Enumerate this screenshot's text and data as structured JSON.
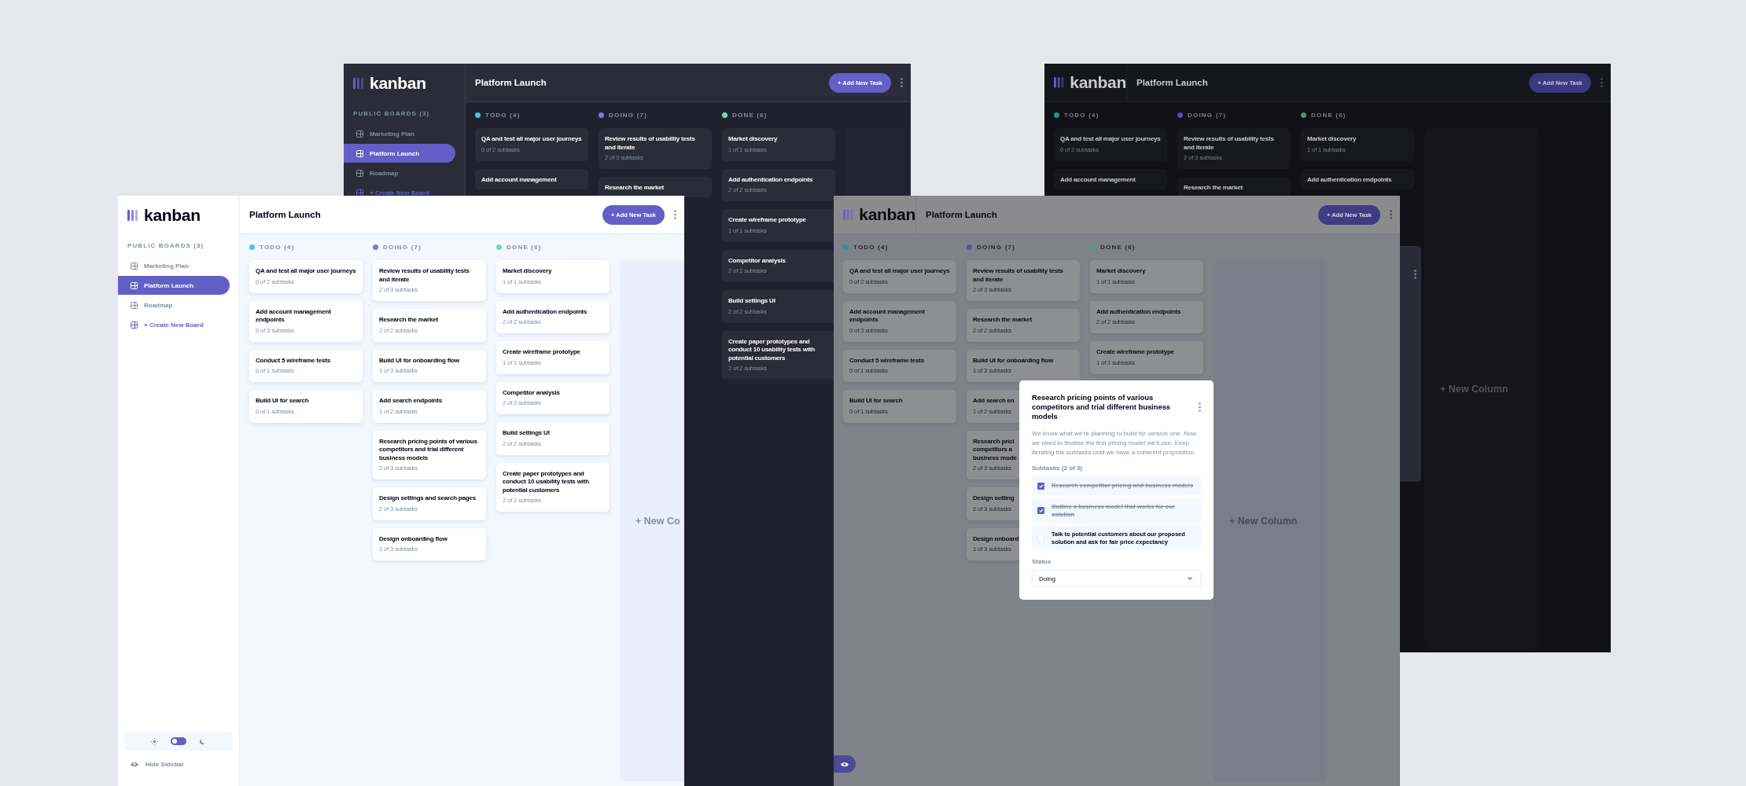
{
  "boards": [
    {
      "kind": "dark",
      "logo": "kanban",
      "sidebar": {
        "heading": "PUBLIC BOARDS (3)",
        "items": [
          {
            "label": "Marketing Plan",
            "selected": false
          },
          {
            "label": "Platform Launch",
            "selected": true
          },
          {
            "label": "Roadmap",
            "selected": false
          }
        ],
        "create_label": "+ Create New Board"
      },
      "title": "Platform Launch",
      "add_button": "+ Add New Task",
      "columns": [
        {
          "name": "TODO (4)",
          "color": "#49c4e5",
          "cards": [
            {
              "title": "QA and test all major user journeys",
              "subtasks": "0 of 2 subtasks"
            },
            {
              "title": "Add account management"
            }
          ]
        },
        {
          "name": "DOING (7)",
          "color": "#8471f2",
          "cards": [
            {
              "title": "Review results of usability tests and iterate",
              "subtasks": "2 of 3 subtasks"
            },
            {
              "title": "Research the market"
            }
          ]
        },
        {
          "name": "DONE (6)",
          "color": "#67e2ae",
          "cards": [
            {
              "title": "Market discovery",
              "subtasks": "1 of 1 subtasks"
            },
            {
              "title": "Add authentication endpoints",
              "subtasks": "2 of 2 subtasks"
            },
            {
              "title": "Create wireframe prototype",
              "subtasks": "1 of 1 subtasks"
            },
            {
              "title": "Competitor analysis",
              "subtasks": "2 of 2 subtasks"
            },
            {
              "title": "Build settings UI",
              "subtasks": "2 of 2 subtasks"
            },
            {
              "title": "Create paper prototypes and conduct 10 usability tests with potential customers",
              "subtasks": "2 of 2 subtasks"
            }
          ]
        }
      ]
    },
    {
      "kind": "dim-dark",
      "logo": "kanban",
      "title": "Platform Launch",
      "add_button": "+ Add New Task",
      "columns": [
        {
          "name": "TODO (4)",
          "color": "#2f8aa3",
          "cards": [
            {
              "title": "QA and test all major user journeys",
              "subtasks": "0 of 2 subtasks"
            },
            {
              "title": "Add account management"
            }
          ]
        },
        {
          "name": "DOING (7)",
          "color": "#5a4cb5",
          "cards": [
            {
              "title": "Review results of usability tests and iterate",
              "subtasks": "2 of 3 subtasks"
            },
            {
              "title": "Research the market"
            }
          ]
        },
        {
          "name": "DONE (6)",
          "color": "#3f9a70",
          "cards": [
            {
              "title": "Market discovery",
              "subtasks": "1 of 1 subtasks"
            },
            {
              "title": "Add authentication endpoints"
            }
          ]
        }
      ],
      "new_column": "+ New Column",
      "modal": {
        "menu": true
      }
    },
    {
      "kind": "light",
      "logo": "kanban",
      "sidebar": {
        "heading": "PUBLIC BOARDS (3)",
        "items": [
          {
            "label": "Marketing Plan",
            "selected": false
          },
          {
            "label": "Platform Launch",
            "selected": true
          },
          {
            "label": "Roadmap",
            "selected": false
          }
        ],
        "create_label": "+ Create New Board",
        "dark_mode": false,
        "hide_label": "Hide Sidebar"
      },
      "title": "Platform Launch",
      "add_button": "+ Add New Task",
      "columns": [
        {
          "name": "TODO (4)",
          "color": "#49c4e5",
          "cards": [
            {
              "title": "QA and test all major user journeys",
              "subtasks": "0 of 2 subtasks"
            },
            {
              "title": "Add account management endpoints",
              "subtasks": "0 of 3 subtasks"
            },
            {
              "title": "Conduct 5 wireframe tests",
              "subtasks": "0 of 1 subtasks"
            },
            {
              "title": "Build UI for search",
              "subtasks": "0 of 1 subtasks"
            }
          ]
        },
        {
          "name": "DOING (7)",
          "color": "#8471f2",
          "cards": [
            {
              "title": "Review results of usability tests and iterate",
              "subtasks": "2 of 3 subtasks"
            },
            {
              "title": "Research the market",
              "subtasks": "2 of 2 subtasks"
            },
            {
              "title": "Build UI for onboarding flow",
              "subtasks": "1 of 3 subtasks"
            },
            {
              "title": "Add search endpoints",
              "subtasks": "1 of 2 subtasks"
            },
            {
              "title": "Research pricing points of various competitors and trial different business models",
              "subtasks": "2 of 3 subtasks"
            },
            {
              "title": "Design settings and search pages",
              "subtasks": "2 of 3 subtasks"
            },
            {
              "title": "Design onboarding flow",
              "subtasks": "1 of 3 subtasks"
            }
          ]
        },
        {
          "name": "DONE (6)",
          "color": "#67e2ae",
          "cards": [
            {
              "title": "Market discovery",
              "subtasks": "1 of 1 subtasks"
            },
            {
              "title": "Add authentication endpoints",
              "subtasks": "2 of 2 subtasks"
            },
            {
              "title": "Create wireframe prototype",
              "subtasks": "1 of 1 subtasks"
            },
            {
              "title": "Competitor analysis",
              "subtasks": "2 of 2 subtasks"
            },
            {
              "title": "Build settings UI",
              "subtasks": "2 of 2 subtasks"
            },
            {
              "title": "Create paper prototypes and conduct 10 usability tests with potential customers",
              "subtasks": "2 of 2 subtasks"
            }
          ]
        }
      ],
      "new_column": "+ New Co"
    },
    {
      "kind": "dim-light",
      "logo": "kanban",
      "title": "Platform Launch",
      "add_button": "+ Add New Task",
      "columns": [
        {
          "name": "TODO (4)",
          "color": "#2f8fa6",
          "cards": [
            {
              "title": "QA and test all major user journeys",
              "subtasks": "0 of 2 subtasks"
            },
            {
              "title": "Add account management endpoints",
              "subtasks": "0 of 3 subtasks"
            },
            {
              "title": "Conduct 5 wireframe tests",
              "subtasks": "0 of 1 subtasks"
            },
            {
              "title": "Build UI for search",
              "subtasks": "0 of 1 subtasks"
            }
          ]
        },
        {
          "name": "DOING (7)",
          "color": "#5b4fb3",
          "cards": [
            {
              "title": "Review results of usability tests and iterate",
              "subtasks": "2 of 3 subtasks"
            },
            {
              "title": "Research the market",
              "subtasks": "2 of 2 subtasks"
            },
            {
              "title": "Build UI for onboarding flow",
              "subtasks": "1 of 3 subtasks"
            },
            {
              "title": "Add search en",
              "subtasks": "1 of 2 subtasks"
            },
            {
              "title": "Research prici\ncompetitors a\nbusiness mode",
              "subtasks": "2 of 3 subtasks"
            },
            {
              "title": "Design setting",
              "subtasks": "2 of 3 subtasks"
            },
            {
              "title": "Design onboard",
              "subtasks": "1 of 3 subtasks"
            }
          ]
        },
        {
          "name": "DONE (6)",
          "color": "#45a37c",
          "cards": [
            {
              "title": "Market discovery",
              "subtasks": "1 of 1 subtasks"
            },
            {
              "title": "Add authentication endpoints",
              "subtasks": "2 of 2 subtasks"
            },
            {
              "title": "Create wireframe prototype",
              "subtasks": "1 of 1 subtasks"
            }
          ]
        }
      ],
      "new_column": "+ New Column",
      "show_sidebar_button": true,
      "modal": {
        "title": "Research pricing points of various competitors and trial different business models",
        "description": "We know what we're planning to build for version one. Now we need to finalise the first pricing model we'll use. Keep iterating the subtasks until we have a coherent proposition.",
        "subtasks_label": "Subtasks (2 of 3)",
        "subtasks": [
          {
            "label": "Research competitor pricing and business models",
            "checked": true
          },
          {
            "label": "Outline a business model that works for our solution",
            "checked": true
          },
          {
            "label": "Talk to potential customers about our proposed solution and ask for fair price expectancy",
            "checked": false
          }
        ],
        "status_label": "Status",
        "status": "Doing"
      }
    }
  ]
}
